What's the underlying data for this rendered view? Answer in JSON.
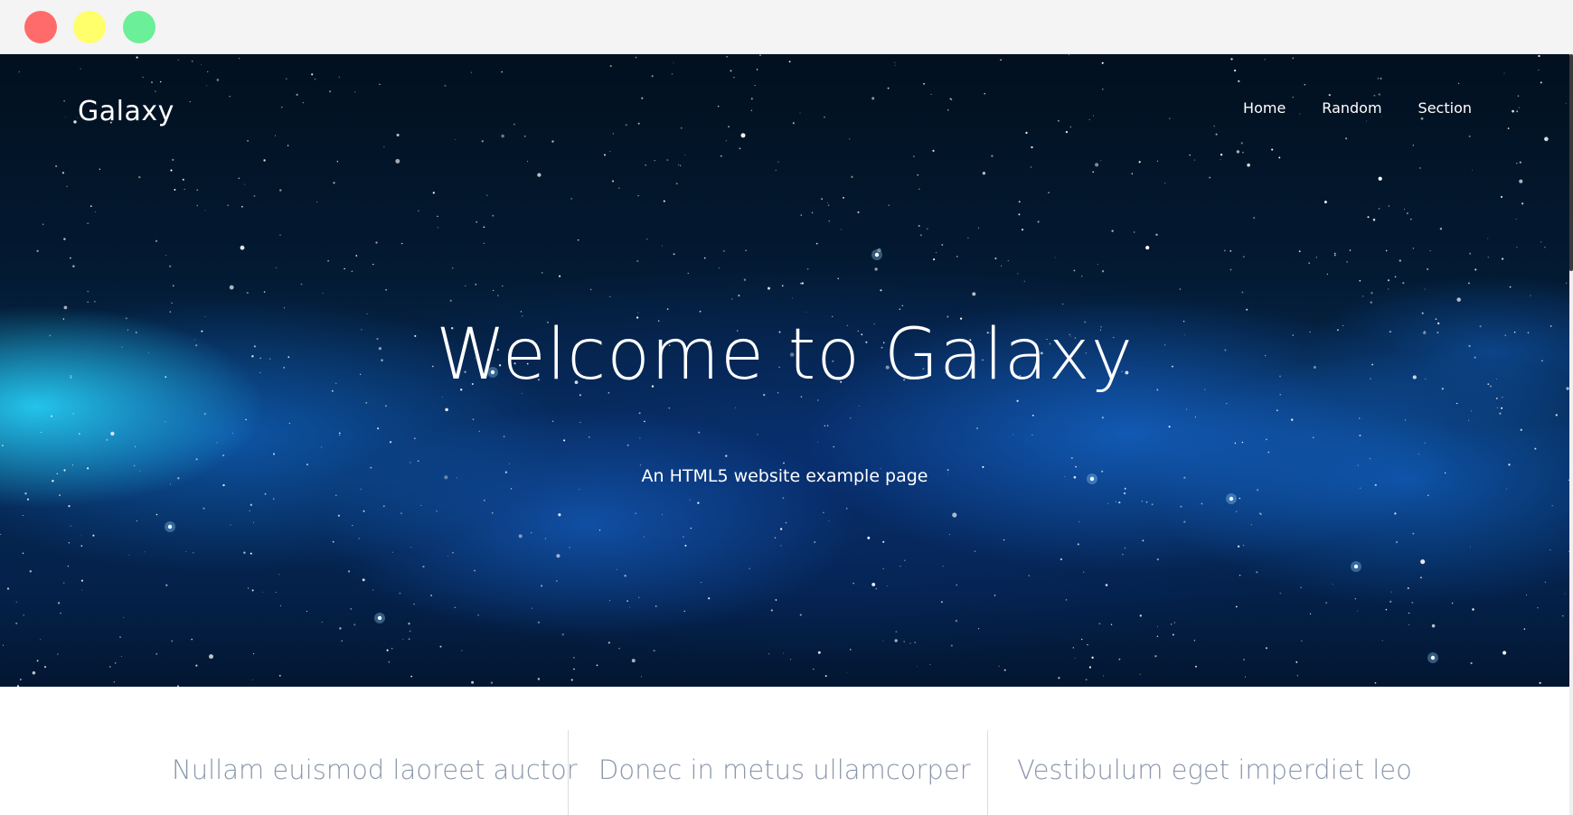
{
  "window": {
    "controls": {
      "close_color": "#ff6b6b",
      "minimize_color": "#ffff6b",
      "zoom_color": "#6bef98"
    }
  },
  "header": {
    "brand": "Galaxy",
    "nav": [
      {
        "label": "Home"
      },
      {
        "label": "Random"
      },
      {
        "label": "Section"
      }
    ]
  },
  "hero": {
    "title": "Welcome to Galaxy",
    "subtitle": "An HTML5 website example page",
    "background_icon": "starfield-galaxy-image"
  },
  "features": [
    {
      "title": "Nullam euismod laoreet auctor"
    },
    {
      "title": "Donec in metus ullamcorper"
    },
    {
      "title": "Vestibulum eget imperdiet leo"
    }
  ]
}
